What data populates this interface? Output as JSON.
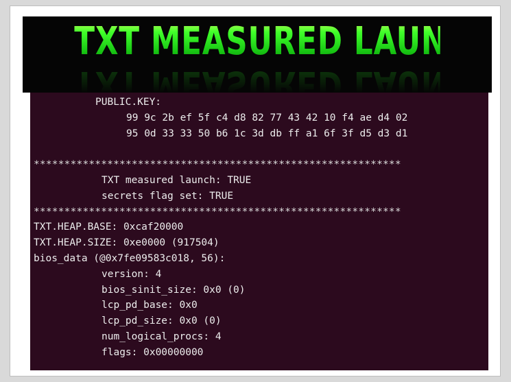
{
  "banner": {
    "title": "TXT MEASURED LAUNCH: TRUE"
  },
  "terminal": {
    "public_key_label": "PUBLIC.KEY:",
    "key_line_1": "99 9c 2b ef 5f c4 d8 82 77 43 42 10 f4 ae d4 02",
    "key_line_2": "95 0d 33 33 50 b6 1c 3d db ff a1 6f 3f d5 d3 d1",
    "separator": "************************************************************",
    "measured_launch": "TXT measured launch: TRUE",
    "secrets_flag": "secrets flag set: TRUE",
    "heap_base": "TXT.HEAP.BASE: 0xcaf20000",
    "heap_size": "TXT.HEAP.SIZE: 0xe0000 (917504)",
    "bios_data": "bios_data (@0x7fe09583c018, 56):",
    "version": "version: 4",
    "bios_sinit_size": "bios_sinit_size: 0x0 (0)",
    "lcp_pd_base": "lcp_pd_base: 0x0",
    "lcp_pd_size": "lcp_pd_size: 0x0 (0)",
    "num_logical_procs": "num_logical_procs: 4",
    "flags": "flags: 0x00000000"
  },
  "colors": {
    "terminal_background": "#2c0a1e",
    "terminal_text": "#ededed",
    "banner_background": "#050505",
    "banner_green": "#23e81a"
  }
}
